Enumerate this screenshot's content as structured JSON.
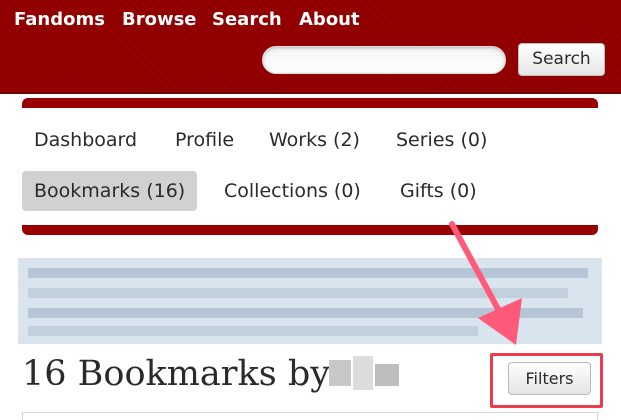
{
  "header": {
    "nav": [
      "Fandoms",
      "Browse",
      "Search",
      "About"
    ],
    "search_placeholder": "",
    "search_button": "Search",
    "background_color": "#990000"
  },
  "dashboard": {
    "links_row1": [
      "Dashboard",
      "Profile",
      "Works (2)",
      "Series (0)"
    ],
    "links_row2": [
      "Bookmarks (16)",
      "Collections (0)",
      "Gifts (0)"
    ],
    "current": "Bookmarks (16)"
  },
  "main": {
    "heading": "16 Bookmarks by",
    "filters_button": "Filters"
  },
  "annotation": {
    "highlight_color": "#ee3a4d",
    "arrow_color": "#ff5a7a"
  }
}
